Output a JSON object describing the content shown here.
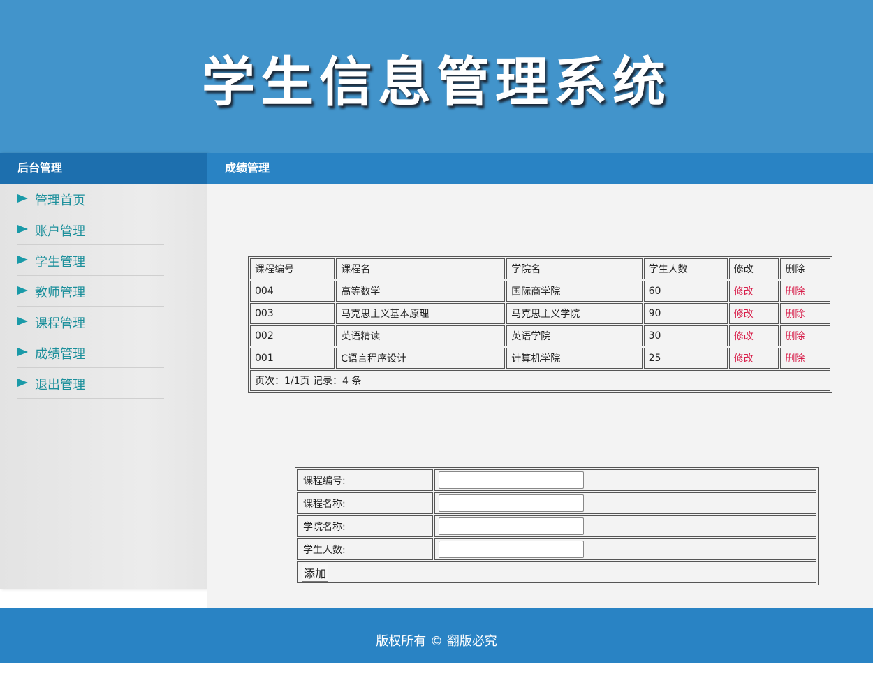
{
  "header": {
    "title": "学生信息管理系统"
  },
  "sidebar": {
    "heading": "后台管理",
    "items": [
      {
        "label": "管理首页"
      },
      {
        "label": "账户管理"
      },
      {
        "label": "学生管理"
      },
      {
        "label": "教师管理"
      },
      {
        "label": "课程管理"
      },
      {
        "label": "成绩管理"
      },
      {
        "label": "退出管理"
      }
    ]
  },
  "main": {
    "heading": "成绩管理",
    "table": {
      "columns": [
        "课程编号",
        "课程名",
        "学院名",
        "学生人数",
        "修改",
        "删除"
      ],
      "rows": [
        {
          "id": "004",
          "course": "高等数学",
          "college": "国际商学院",
          "count": "60",
          "edit": "修改",
          "delete": "删除"
        },
        {
          "id": "003",
          "course": "马克思主义基本原理",
          "college": "马克思主义学院",
          "count": "90",
          "edit": "修改",
          "delete": "删除"
        },
        {
          "id": "002",
          "course": "英语精读",
          "college": "英语学院",
          "count": "30",
          "edit": "修改",
          "delete": "删除"
        },
        {
          "id": "001",
          "course": "C语言程序设计",
          "college": "计算机学院",
          "count": "25",
          "edit": "修改",
          "delete": "删除"
        }
      ],
      "pager": "页次：1/1页 记录：4 条"
    },
    "form": {
      "fields": [
        {
          "label": "课程编号:",
          "value": ""
        },
        {
          "label": "课程名称:",
          "value": ""
        },
        {
          "label": "学院名称:",
          "value": ""
        },
        {
          "label": "学生人数:",
          "value": ""
        }
      ],
      "submit_label": "添加"
    }
  },
  "footer": {
    "text": "版权所有 © 翻版必究"
  },
  "colors": {
    "banner": "#4294cb",
    "nav_bar": "#2983c4",
    "sidebar_head": "#1d6fae",
    "menu_text": "#1b8f9b",
    "link_red": "#d81e4a"
  }
}
